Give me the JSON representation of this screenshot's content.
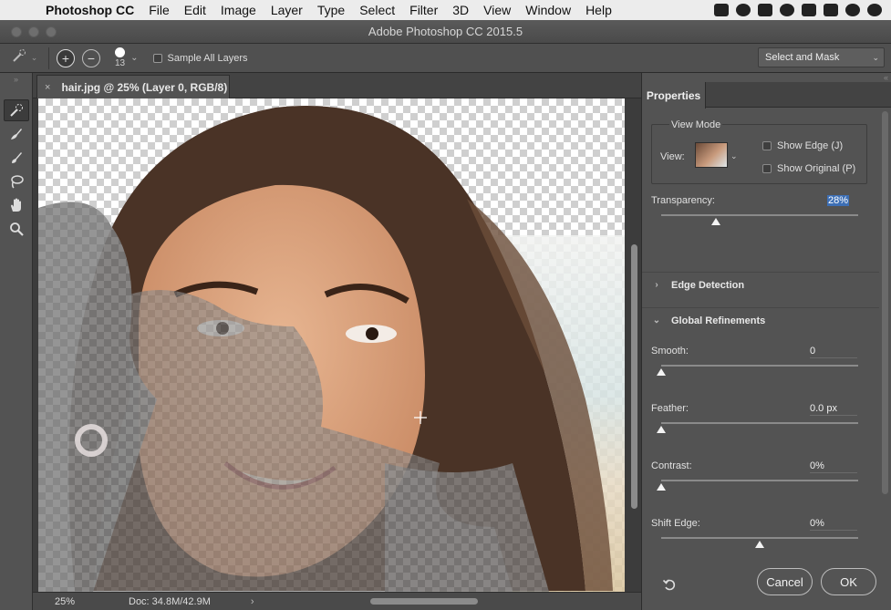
{
  "menubar": {
    "app": "Photoshop CC",
    "items": [
      "File",
      "Edit",
      "Image",
      "Layer",
      "Type",
      "Select",
      "Filter",
      "3D",
      "View",
      "Window",
      "Help"
    ]
  },
  "window": {
    "title": "Adobe Photoshop CC 2015.5"
  },
  "options": {
    "brush_size": "13",
    "sample_all_layers": "Sample All Layers",
    "select_and_mask": "Select and Mask"
  },
  "document": {
    "tab_title": "hair.jpg @ 25% (Layer 0, RGB/8)",
    "close": "×"
  },
  "status": {
    "zoom": "25%",
    "doc_size": "Doc: 34.8M/42.9M",
    "arrow": "›"
  },
  "properties": {
    "tab": "Properties",
    "view_mode": {
      "heading": "View Mode",
      "view_label": "View:",
      "show_edge": "Show Edge (J)",
      "show_original": "Show Original (P)"
    },
    "transparency": {
      "label": "Transparency:",
      "value": "28%",
      "fraction": 0.28
    },
    "edge_detection": {
      "label": "Edge Detection",
      "collapsed": true
    },
    "global_refinements": {
      "label": "Global Refinements",
      "smooth": {
        "label": "Smooth:",
        "value": "0",
        "fraction": 0.0
      },
      "feather": {
        "label": "Feather:",
        "value": "0.0 px",
        "fraction": 0.0
      },
      "contrast": {
        "label": "Contrast:",
        "value": "0%",
        "fraction": 0.0
      },
      "shift_edge": {
        "label": "Shift Edge:",
        "value": "0%",
        "fraction": 0.5
      }
    },
    "buttons": {
      "cancel": "Cancel",
      "ok": "OK"
    }
  },
  "colors": {
    "panel": "#535353",
    "highlight": "#3d6fb5"
  }
}
